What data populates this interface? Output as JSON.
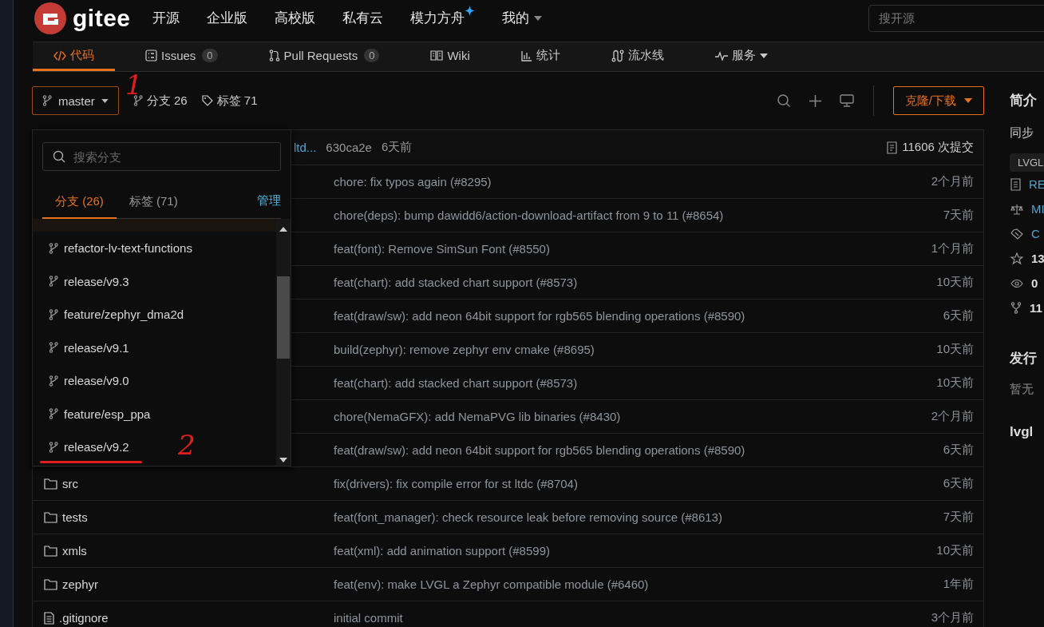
{
  "header": {
    "logo": "gitee",
    "nav": [
      {
        "label": "开源",
        "kind": "plain"
      },
      {
        "label": "企业版",
        "kind": "plain"
      },
      {
        "label": "高校版",
        "kind": "plain"
      },
      {
        "label": "私有云",
        "kind": "plain"
      },
      {
        "label": "模力方舟",
        "kind": "sparkle"
      },
      {
        "label": "我的",
        "kind": "menu"
      }
    ],
    "search": {
      "placeholder": "搜开源"
    }
  },
  "tabs": [
    {
      "label": "代码",
      "kind": "code",
      "selected": true
    },
    {
      "label": "Issues",
      "kind": "issues",
      "count": "0",
      "selected": false
    },
    {
      "label": "Pull Requests",
      "kind": "pulls",
      "count": "0",
      "selected": false
    },
    {
      "label": "Wiki",
      "kind": "wiki",
      "selected": false
    },
    {
      "label": "统计",
      "kind": "stats",
      "selected": false
    },
    {
      "label": "流水线",
      "kind": "pipeline",
      "selected": false
    },
    {
      "label": "服务",
      "kind": "services",
      "selected": false
    }
  ],
  "toolbar": {
    "branch": "master",
    "branches": "分支 26",
    "tags": "标签 71",
    "clone_button": "克隆/下载"
  },
  "commit_bar": {
    "message": "ltd...",
    "hash": "630ca2e",
    "time": "6天前",
    "commits": "11606 次提交"
  },
  "files": [
    {
      "message": "chore: fix typos again (#8295)",
      "time": "2个月前"
    },
    {
      "message": "chore(deps): bump dawidd6/action-download-artifact from 9 to 11 (#8654)",
      "time": "7天前"
    },
    {
      "message": "feat(font): Remove SimSun Font (#8550)",
      "time": "1个月前"
    },
    {
      "message": "feat(chart): add stacked chart support (#8573)",
      "time": "10天前"
    },
    {
      "message": "feat(draw/sw): add neon 64bit support for rgb565 blending operations (#8590)",
      "time": "6天前"
    },
    {
      "message": "build(zephyr): remove zephyr env cmake (#8695)",
      "time": "10天前"
    },
    {
      "message": "feat(chart): add stacked chart support (#8573)",
      "time": "10天前"
    },
    {
      "message": "chore(NemaGFX): add NemaPVG lib binaries (#8430)",
      "time": "2个月前"
    },
    {
      "message": "feat(draw/sw): add neon 64bit support for rgb565 blending operations (#8590)",
      "time": "6天前"
    },
    {
      "name": "src",
      "kind": "folder",
      "message": "fix(drivers): fix compile error for st ltdc (#8704)",
      "time": "6天前"
    },
    {
      "name": "tests",
      "kind": "folder",
      "message": "feat(font_manager): check resource leak before removing source (#8613)",
      "time": "7天前"
    },
    {
      "name": "xmls",
      "kind": "folder",
      "message": "feat(xml): add animation support (#8599)",
      "time": "10天前"
    },
    {
      "name": "zephyr",
      "kind": "folder",
      "message": "feat(env): make LVGL a Zephyr compatible module (#6460)",
      "time": "1年前"
    },
    {
      "name": ".gitignore",
      "kind": "file",
      "message": "initial commit",
      "time": "3个月前"
    }
  ],
  "branch_menu": {
    "search": {
      "placeholder": "搜索分支"
    },
    "tabs": [
      {
        "label": "分支 (26)",
        "selected": true
      },
      {
        "label": "标签 (71)",
        "selected": false
      }
    ],
    "manage": "管理",
    "branches": [
      "refactor-lv-text-functions",
      "release/v9.3",
      "feature/zephyr_dma2d",
      "release/v9.1",
      "release/v9.0",
      "feature/esp_ppa",
      "release/v9.2"
    ]
  },
  "sidebar": {
    "title": "简介",
    "description": "同步",
    "tag": "LVGL",
    "links": [
      {
        "kind": "readme",
        "label": "RE"
      },
      {
        "kind": "license",
        "label": "MI"
      },
      {
        "kind": "contributing",
        "label": "C"
      }
    ],
    "stats": [
      {
        "kind": "stars",
        "value": "13"
      },
      {
        "kind": "watch",
        "value": "0"
      },
      {
        "kind": "forks",
        "value": "11"
      }
    ],
    "releases_title": "发行",
    "releases_empty": "暂无",
    "footer_title": "lvgl"
  },
  "annotations": [
    {
      "text": "1",
      "underline": false
    },
    {
      "text": "2",
      "underline": true
    }
  ]
}
